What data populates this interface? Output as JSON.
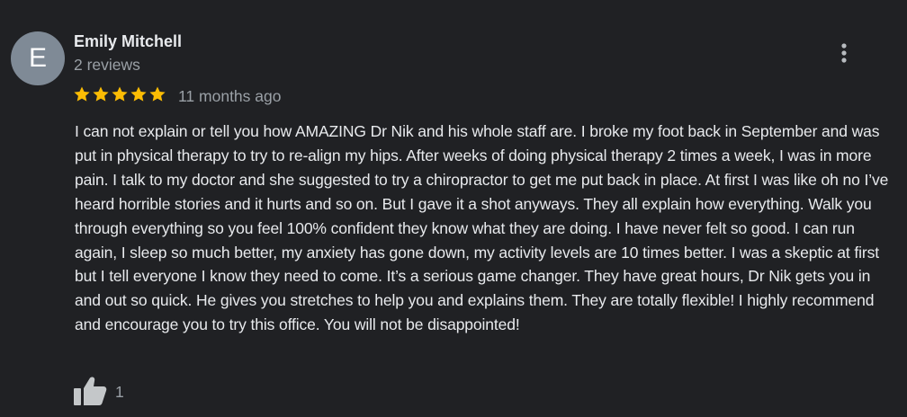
{
  "review": {
    "avatar_letter": "E",
    "avatar_color": "#7f8a96",
    "author_name": "Emily Mitchell",
    "review_count": "2 reviews",
    "rating": 5,
    "rating_max": 5,
    "star_color": "#fbbc04",
    "time_ago": "11 months ago",
    "text": "I can not explain or tell you how AMAZING Dr Nik and his whole staff are. I broke my foot back in September and was put in physical therapy to try to re-align my hips. After weeks of doing physical therapy 2 times a week, I was in more pain. I talk to my doctor and she suggested to try a chiropractor to get me put back in place. At first I was like oh no I’ve heard horrible stories and it hurts and so on. But I gave it a shot anyways. They all explain how everything. Walk you through everything so you feel 100% confident they know what they are doing. I have never felt so good. I can run again, I sleep so much better, my anxiety has gone down, my activity levels are 10 times better. I was a skeptic at first but I tell everyone I know they need to come. It’s a serious game changer. They have great hours, Dr Nik gets you in and out so quick. He gives you stretches to help you and explains them. They are totally flexible! I highly recommend and encourage you to try this office. You will not be disappointed!",
    "like_count": "1",
    "icons": {
      "more": "more-vert-icon",
      "like": "thumb-up-icon",
      "star": "star-icon"
    }
  }
}
